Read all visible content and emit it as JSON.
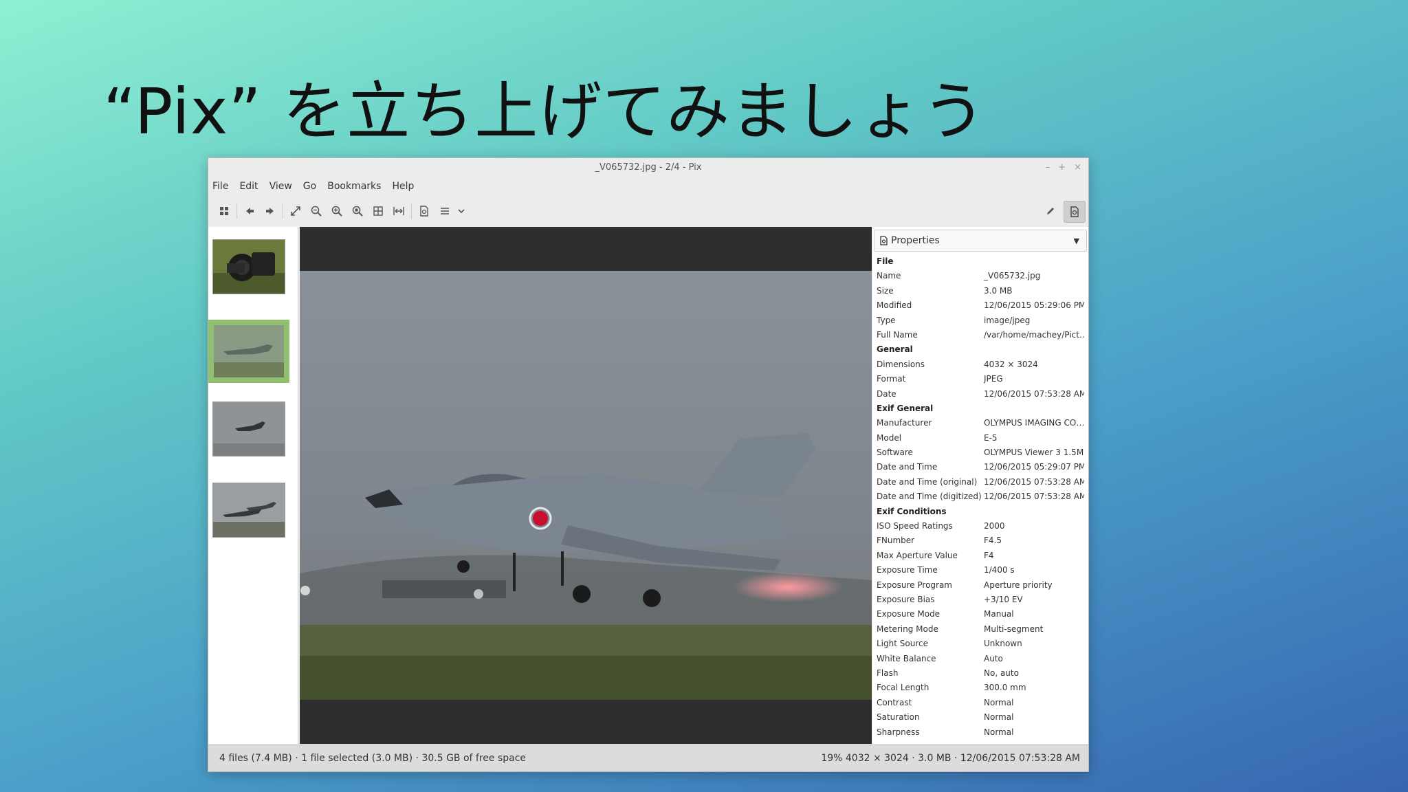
{
  "slide": {
    "title": "“Pix” を立ち上げてみましょう"
  },
  "window": {
    "title": "_V065732.jpg - 2/4 - Pix",
    "controls": {
      "minimize": "–",
      "maximize": "+",
      "close": "×"
    }
  },
  "menu": [
    "File",
    "Edit",
    "View",
    "Go",
    "Bookmarks",
    "Help"
  ],
  "toolbar": {
    "icons": [
      "browser-icon",
      "back-icon",
      "forward-icon",
      "fullscreen-icon",
      "zoom-out-icon",
      "zoom-in-icon",
      "zoom-fit-icon",
      "zoom-grid-icon",
      "fit-width-icon",
      "properties-icon",
      "menu-icon",
      "dropdown-icon"
    ],
    "right_icons": [
      "edit-icon",
      "properties-icon"
    ]
  },
  "thumbnails": [
    {
      "label": "camera",
      "selected": false
    },
    {
      "label": "jet-runway",
      "selected": true
    },
    {
      "label": "jet-flying",
      "selected": false
    },
    {
      "label": "jets-landing",
      "selected": false
    }
  ],
  "properties": {
    "header": "Properties",
    "sections": [
      {
        "title": "File",
        "rows": [
          [
            "Name",
            "_V065732.jpg"
          ],
          [
            "Size",
            "3.0 MB"
          ],
          [
            "Modified",
            "12/06/2015 05:29:06 PM"
          ],
          [
            "Type",
            "image/jpeg"
          ],
          [
            "Full Name",
            "/var/home/machey/Pict…"
          ]
        ]
      },
      {
        "title": "General",
        "rows": [
          [
            "Dimensions",
            "4032 × 3024"
          ],
          [
            "Format",
            "JPEG"
          ],
          [
            "Date",
            "12/06/2015 07:53:28 AM"
          ]
        ]
      },
      {
        "title": "Exif General",
        "rows": [
          [
            "Manufacturer",
            "OLYMPUS IMAGING CO…"
          ],
          [
            "Model",
            "E-5"
          ],
          [
            "Software",
            "OLYMPUS Viewer 3 1.5M"
          ],
          [
            "Date and Time",
            "12/06/2015 05:29:07 PM"
          ],
          [
            "Date and Time (original)",
            "12/06/2015 07:53:28 AM"
          ],
          [
            "Date and Time (digitized)",
            "12/06/2015 07:53:28 AM"
          ]
        ]
      },
      {
        "title": "Exif Conditions",
        "rows": [
          [
            "ISO Speed Ratings",
            "2000"
          ],
          [
            "FNumber",
            "F4.5"
          ],
          [
            "Max Aperture Value",
            "F4"
          ],
          [
            "Exposure Time",
            "1/400 s"
          ],
          [
            "Exposure Program",
            "Aperture priority"
          ],
          [
            "Exposure Bias",
            "+3/10 EV"
          ],
          [
            "Exposure Mode",
            "Manual"
          ],
          [
            "Metering Mode",
            "Multi-segment"
          ],
          [
            "Light Source",
            "Unknown"
          ],
          [
            "White Balance",
            "Auto"
          ],
          [
            "Flash",
            "No, auto"
          ],
          [
            "Focal Length",
            "300.0 mm"
          ],
          [
            "Contrast",
            "Normal"
          ],
          [
            "Saturation",
            "Normal"
          ],
          [
            "Sharpness",
            "Normal"
          ]
        ]
      }
    ]
  },
  "statusbar": {
    "left": "4 files (7.4 MB) · 1 file selected (3.0 MB) · 30.5 GB of free space",
    "right": "19%  4032 × 3024 · 3.0 MB · 12/06/2015 07:53:28 AM"
  }
}
